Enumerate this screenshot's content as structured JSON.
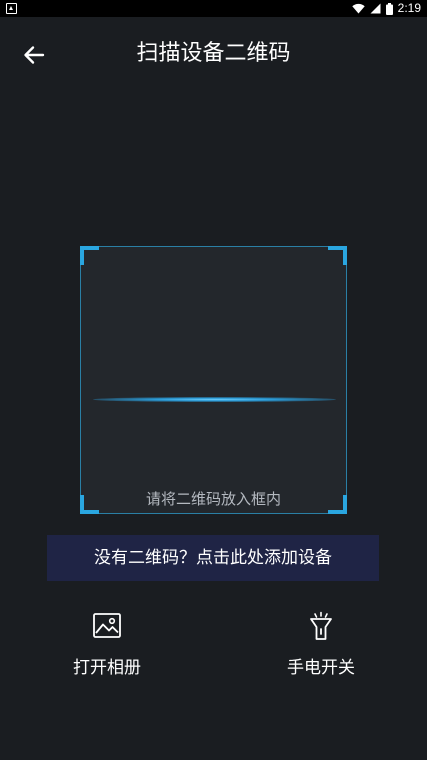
{
  "status_bar": {
    "time": "2:19",
    "icons": [
      "notification-icon",
      "wifi-icon",
      "signal-icon",
      "battery-icon"
    ]
  },
  "header": {
    "title": "扫描设备二维码",
    "back_icon": "arrow-left-icon"
  },
  "scanner": {
    "hint": "请将二维码放入框内",
    "accent_color": "#2aa6e0"
  },
  "add_device": {
    "label": "没有二维码？点击此处添加设备"
  },
  "actions": {
    "album": {
      "label": "打开相册",
      "icon": "image-icon"
    },
    "torch": {
      "label": "手电开关",
      "icon": "flashlight-icon"
    }
  },
  "colors": {
    "background": "#1a1d21",
    "banner": "#1f2445",
    "scan_line": "#2a9ad6"
  }
}
